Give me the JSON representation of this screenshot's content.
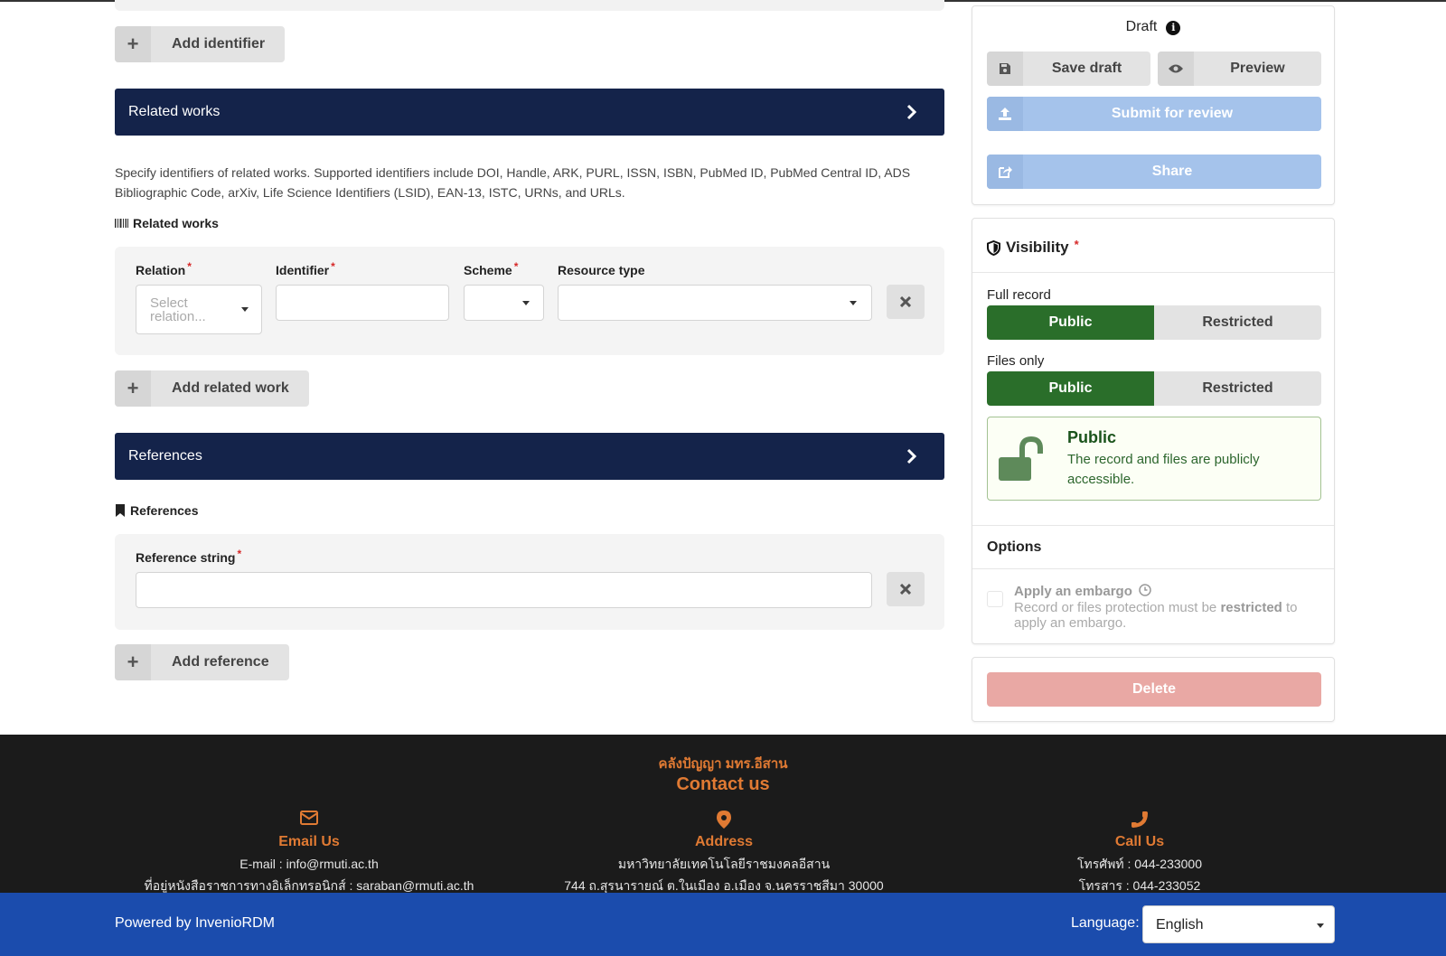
{
  "identifiers": {
    "add_label": "Add identifier"
  },
  "related_works": {
    "accordion_title": "Related works",
    "help_text": "Specify identifiers of related works. Supported identifiers include DOI, Handle, ARK, PURL, ISSN, ISBN, PubMed ID, PubMed Central ID, ADS Bibliographic Code, arXiv, Life Science Identifiers (LSID), EAN-13, ISTC, URNs, and URLs.",
    "section_label": "Related works",
    "fields": {
      "relation_label": "Relation",
      "relation_placeholder": "Select relation...",
      "identifier_label": "Identifier",
      "scheme_label": "Scheme",
      "resource_type_label": "Resource type",
      "required_mark": "*"
    },
    "add_label": "Add related work"
  },
  "references": {
    "accordion_title": "References",
    "section_label": "References",
    "field_label": "Reference string",
    "add_label": "Add reference"
  },
  "sidebar": {
    "status": "Draft",
    "save_draft": "Save draft",
    "preview": "Preview",
    "submit": "Submit for review",
    "share": "Share",
    "visibility": {
      "title": "Visibility",
      "full_record_label": "Full record",
      "files_only_label": "Files only",
      "public": "Public",
      "restricted": "Restricted",
      "notice_title": "Public",
      "notice_desc": "The record and files are publicly accessible."
    },
    "options": {
      "title": "Options",
      "embargo_title": "Apply an embargo",
      "embargo_desc_pre": "Record or files protection must be",
      "embargo_desc_bold": "restricted",
      "embargo_desc_post": "to apply an embargo."
    },
    "delete": "Delete"
  },
  "footer": {
    "site_name": "คลังปัญญา มทร.อีสาน",
    "contact_title": "Contact us",
    "email": {
      "heading": "Email Us",
      "line1": "E-mail : info@rmuti.ac.th",
      "line2": "ที่อยู่หนังสือราชการทางอิเล็กทรอนิกส์ : saraban@rmuti.ac.th"
    },
    "address": {
      "heading": "Address",
      "line1": "มหาวิทยาลัยเทคโนโลยีราชมงคลอีสาน",
      "line2": "744 ถ.สุรนารายณ์ ต.ในเมือง อ.เมือง จ.นครราชสีมา 30000"
    },
    "call": {
      "heading": "Call Us",
      "line1": "โทรศัพท์ : 044-233000",
      "line2": "โทรสาร : 044-233052"
    }
  },
  "bottom_bar": {
    "powered_by": "Powered by InvenioRDM",
    "language_label": "Language:",
    "language_value": "English"
  },
  "colors": {
    "accordion": "#14234a",
    "public_green": "#2a6e2a",
    "footer_bg": "#1b1b1b",
    "footer_accent": "#e07a33",
    "bottom_bar": "#1b4cad"
  }
}
